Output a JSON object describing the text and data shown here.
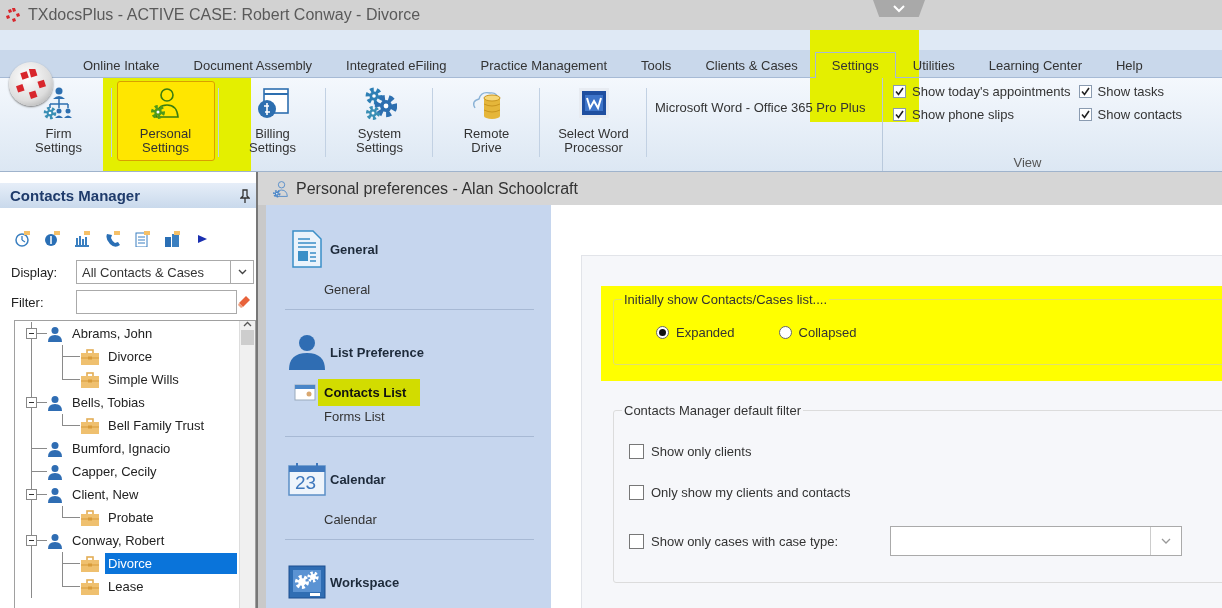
{
  "window": {
    "title": "TXdocsPlus - ACTIVE CASE: Robert Conway - Divorce"
  },
  "ribbon": {
    "tabs": [
      {
        "label": "Online Intake",
        "selected": false,
        "highlighted": false
      },
      {
        "label": "Document Assembly",
        "selected": false,
        "highlighted": false
      },
      {
        "label": "Integrated eFiling",
        "selected": false,
        "highlighted": false
      },
      {
        "label": "Practice Management",
        "selected": false,
        "highlighted": false
      },
      {
        "label": "Tools",
        "selected": false,
        "highlighted": false
      },
      {
        "label": "Clients & Cases",
        "selected": false,
        "highlighted": false
      },
      {
        "label": "Settings",
        "selected": true,
        "highlighted": true
      },
      {
        "label": "Utilities",
        "selected": false,
        "highlighted": false
      },
      {
        "label": "Learning Center",
        "selected": false,
        "highlighted": false
      },
      {
        "label": "Help",
        "selected": false,
        "highlighted": false
      }
    ],
    "buttons": [
      {
        "label": "Firm Settings",
        "kind": "org_chart",
        "selected": false,
        "highlighted": false
      },
      {
        "label": "Personal Settings",
        "kind": "person_gear",
        "selected": true,
        "highlighted": true
      },
      {
        "label": "Billing Settings",
        "kind": "billing",
        "selected": false,
        "highlighted": false
      },
      {
        "label": "System Settings",
        "kind": "gears",
        "selected": false,
        "highlighted": false
      },
      {
        "label": "Remote Drive",
        "kind": "cloud_drive",
        "selected": false,
        "highlighted": false
      },
      {
        "label": "Select Word Processor",
        "kind": "word",
        "selected": false,
        "highlighted": false
      }
    ],
    "word_processor": "Microsoft Word - Office 365 Pro Plus",
    "view": {
      "title": "View",
      "options": [
        {
          "label": "Show today's appointments",
          "checked": true
        },
        {
          "label": "Show tasks",
          "checked": true
        },
        {
          "label": "Show phone slips",
          "checked": true
        },
        {
          "label": "Show contacts",
          "checked": true
        }
      ]
    }
  },
  "contacts_manager": {
    "title": "Contacts Manager",
    "display": {
      "label": "Display:",
      "value": "All Contacts & Cases"
    },
    "filter": {
      "label": "Filter:"
    },
    "tree": [
      {
        "label": "Abrams, John",
        "kind": "contact",
        "selected": false,
        "expanded": true,
        "children": [
          {
            "label": "Divorce",
            "kind": "case",
            "selected": false
          },
          {
            "label": "Simple Wills",
            "kind": "case",
            "selected": false
          }
        ]
      },
      {
        "label": "Bells, Tobias",
        "kind": "contact",
        "selected": false,
        "expanded": true,
        "children": [
          {
            "label": "Bell Family Trust",
            "kind": "case",
            "selected": false
          }
        ]
      },
      {
        "label": "Bumford, Ignacio",
        "kind": "contact",
        "selected": false
      },
      {
        "label": "Capper, Cecily",
        "kind": "contact",
        "selected": false
      },
      {
        "label": "Client, New",
        "kind": "contact",
        "selected": false,
        "expanded": true,
        "children": [
          {
            "label": "Probate",
            "kind": "case",
            "selected": false
          }
        ]
      },
      {
        "label": "Conway, Robert",
        "kind": "contact",
        "selected": false,
        "expanded": true,
        "children": [
          {
            "label": "Divorce",
            "kind": "case",
            "selected": true
          },
          {
            "label": "Lease",
            "kind": "case",
            "selected": false
          }
        ]
      }
    ]
  },
  "preferences": {
    "title": "Personal preferences - Alan Schoolcraft",
    "nav": [
      {
        "title": "General",
        "kind": "document",
        "items": [
          {
            "label": "General",
            "selected": false,
            "highlighted": false
          }
        ]
      },
      {
        "title": "List Preference",
        "kind": "person",
        "items": [
          {
            "label": "Contacts List",
            "selected": true,
            "highlighted": true
          },
          {
            "label": "Forms List",
            "selected": false,
            "highlighted": false
          }
        ]
      },
      {
        "title": "Calendar",
        "kind": "calendar",
        "icon_text": "23",
        "items": [
          {
            "label": "Calendar",
            "selected": false,
            "highlighted": false
          }
        ]
      },
      {
        "title": "Workspace",
        "kind": "workspace"
      }
    ],
    "groups": [
      {
        "title": "Initially show Contacts/Cases list....",
        "kind": "radio",
        "highlighted": true,
        "options": [
          {
            "label": "Expanded",
            "selected": true
          },
          {
            "label": "Collapsed",
            "selected": false
          }
        ]
      },
      {
        "title": "Contacts Manager default filter",
        "kind": "checkbox",
        "highlighted": false,
        "options": [
          {
            "label": "Show only clients",
            "kind": "checkbox",
            "checked": false
          },
          {
            "label": "Only show my clients and contacts",
            "kind": "checkbox",
            "checked": false
          },
          {
            "label": "Show only cases with case type:",
            "kind": "checkbox_dropdown",
            "checked": false
          }
        ]
      }
    ]
  }
}
